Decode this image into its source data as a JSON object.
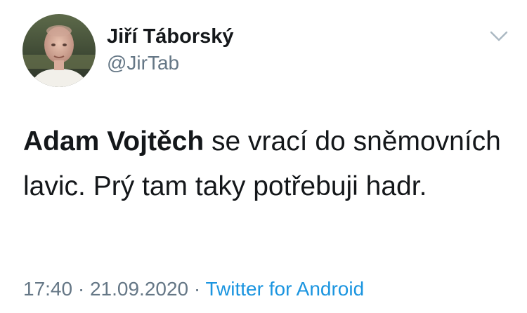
{
  "tweet": {
    "display_name": "Jiří Táborský",
    "handle": "@JirTab",
    "text_bold": "Adam Vojtěch",
    "text_rest": " se vrací do sněmovních lavic. Prý tam taky potřebuji hadr.",
    "time": "17:40",
    "separator": " · ",
    "date": "21.09.2020",
    "separator2": " · ",
    "source": "Twitter for Android"
  },
  "icons": {
    "menu": "chevron-down-icon",
    "avatar": "profile-photo"
  },
  "colors": {
    "text": "#14171a",
    "secondary": "#657786",
    "link": "#1b95e0",
    "chevron": "#aab8c2"
  }
}
